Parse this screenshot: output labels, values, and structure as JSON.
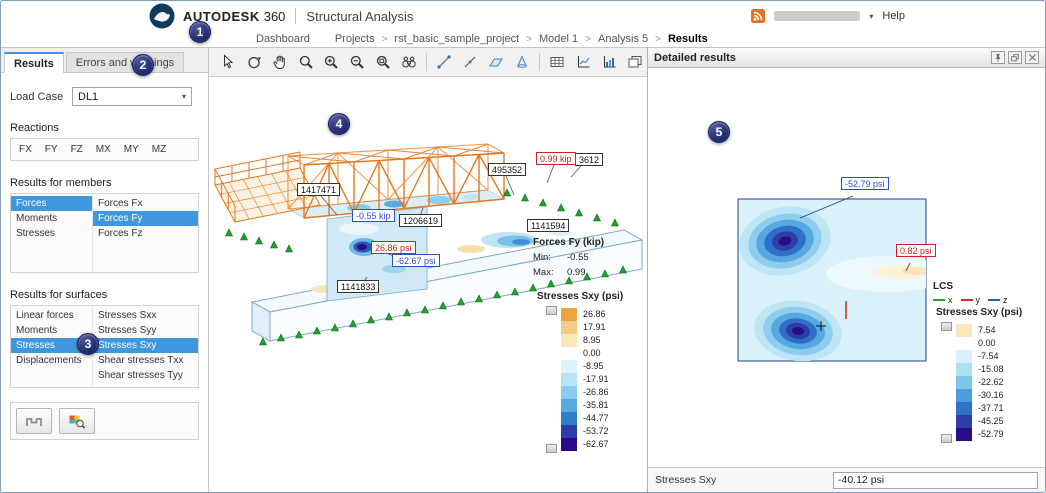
{
  "header": {
    "brand": "AUTODESK",
    "brand_product": "360",
    "app_title": "Structural Analysis",
    "help_label": "Help",
    "breadcrumb": {
      "dashboard": "Dashboard",
      "separator": ">",
      "items": [
        "Projects",
        "rst_basic_sample_project",
        "Model 1",
        "Analysis 5",
        "Results"
      ]
    }
  },
  "callouts": {
    "c1": "1",
    "c2": "2",
    "c3": "3",
    "c4": "4",
    "c5": "5"
  },
  "sidebar": {
    "tabs": {
      "results": "Results",
      "errors": "Errors and warnings"
    },
    "load_case": {
      "label": "Load Case",
      "value": "DL1"
    },
    "reactions": {
      "label": "Reactions",
      "codes": [
        "FX",
        "FY",
        "FZ",
        "MX",
        "MY",
        "MZ"
      ]
    },
    "members": {
      "label": "Results for members",
      "categories": [
        "Forces",
        "Moments",
        "Stresses"
      ],
      "selected_category": "Forces",
      "options": [
        "Forces Fx",
        "Forces Fy",
        "Forces Fz"
      ],
      "selected_option": "Forces Fy"
    },
    "surfaces": {
      "label": "Results for surfaces",
      "categories": [
        "Linear forces",
        "Moments",
        "Stresses",
        "Displacements"
      ],
      "selected_category": "Stresses",
      "options": [
        "Stresses Sxx",
        "Stresses Syy",
        "Stresses Sxy",
        "Shear stresses Txx",
        "Shear stresses Tyy"
      ],
      "selected_option": "Stresses Sxy"
    }
  },
  "viewport": {
    "labels": {
      "node_a": "1417471",
      "node_b": "1206619",
      "node_c": "495352",
      "node_d": "3612",
      "node_e": "1141594",
      "node_f": "1141833",
      "force_min": "-0.55 kip",
      "force_max": "0.99 kip",
      "stress_min": "-62.67 psi",
      "stress_max": "26.86 psi"
    },
    "forces_legend": {
      "title": "Forces Fy (kip)",
      "min_label": "Min:",
      "min_value": "-0.55",
      "max_label": "Max:",
      "max_value": "0.99"
    },
    "stress_legend": {
      "title": "Stresses Sxy (psi)",
      "entries": [
        {
          "value": "26.86",
          "color": "#F0A240"
        },
        {
          "value": "17.91",
          "color": "#F6C98C"
        },
        {
          "value": "8.95",
          "color": "#FBE7BC"
        },
        {
          "value": "0.00",
          "color": "#FEFEFE"
        },
        {
          "value": "-8.95",
          "color": "#DDF2FA"
        },
        {
          "value": "-17.91",
          "color": "#B8E4F6"
        },
        {
          "value": "-26.86",
          "color": "#8BCDEE"
        },
        {
          "value": "-35.81",
          "color": "#58A9E2"
        },
        {
          "value": "-44.77",
          "color": "#2F7CCB"
        },
        {
          "value": "-53.72",
          "color": "#2B3EA5"
        },
        {
          "value": "-62.67",
          "color": "#2D0A86"
        }
      ]
    }
  },
  "detail": {
    "title": "Detailed results",
    "labels": {
      "min": "-52.79 psi",
      "max": "0.82 psi"
    },
    "lcs": {
      "title": "LCS",
      "x": "x",
      "y": "y",
      "z": "z",
      "x_color": "#2ca02c",
      "y_color": "#d62728",
      "z_color": "#1f5fd0"
    },
    "legend": {
      "title": "Stresses Sxy (psi)",
      "entries": [
        {
          "value": "7.54",
          "color": "#FBE7BC"
        },
        {
          "value": "0.00",
          "color": "#FEFEFE"
        },
        {
          "value": "-7.54",
          "color": "#D9F0FA"
        },
        {
          "value": "-15.08",
          "color": "#AEE0F4"
        },
        {
          "value": "-22.62",
          "color": "#7FC6EA"
        },
        {
          "value": "-30.16",
          "color": "#4E9EDC"
        },
        {
          "value": "-37.71",
          "color": "#2F72C4"
        },
        {
          "value": "-45.25",
          "color": "#2C3EA6"
        },
        {
          "value": "-52.79",
          "color": "#2D0A86"
        }
      ]
    },
    "footer": {
      "label": "Stresses Sxy",
      "value": "-40.12 psi"
    }
  }
}
